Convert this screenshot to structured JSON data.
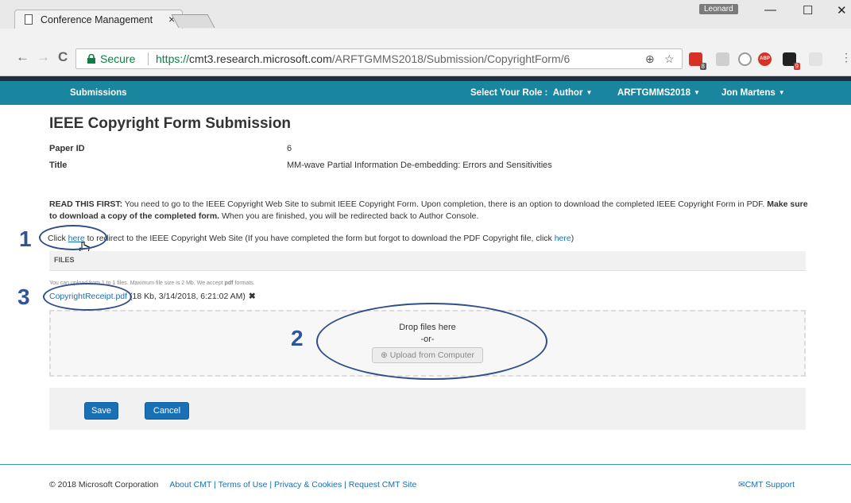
{
  "browser": {
    "tab_title": "Conference Management",
    "tab_close": "×",
    "user_badge": "Leonard",
    "minimize": "—",
    "maximize": "☐",
    "close": "✕",
    "back": "←",
    "forward": "→",
    "reload": "C",
    "secure_label": "Secure",
    "url_scheme": "https://",
    "url_host": "cmt3.research.microsoft.com",
    "url_path": "/ARFTGMMS2018/Submission/CopyrightForm/6",
    "zoom_icon": "⊕",
    "star_icon": "☆",
    "ext_badge_1": "8",
    "ext_abp": "ABP",
    "ext_badge_2": "9",
    "menu": "⋮"
  },
  "nav": {
    "submissions": "Submissions",
    "role_label": "Select Your Role :",
    "role_value": "Author",
    "conference": "ARFTGMMS2018",
    "user": "Jon Martens"
  },
  "page": {
    "title": "IEEE Copyright Form Submission",
    "paper_id_label": "Paper ID",
    "paper_id_value": "6",
    "title_label": "Title",
    "title_value": "MM-wave Partial Information De-embedding: Errors and Sensitivities",
    "notice_bold1": "READ THIS FIRST:",
    "notice_text1": " You need to go to the IEEE Copyright Web Site to submit IEEE Copyright Form. Upon completion, there is an option to download the completed IEEE Copyright Form in PDF. ",
    "notice_bold2": "Make sure to download a copy of the completed form.",
    "notice_text2": " When you are finished, you will be redirected back to Author Console.",
    "redirect_pre": "Click ",
    "redirect_link": "here",
    "redirect_mid": " to redirect to the IEEE Copyright Web Site (If you have completed the form but forgot to download the PDF Copyright file, click ",
    "redirect_link2": "here",
    "redirect_post": ")"
  },
  "files": {
    "header": "FILES",
    "hint_pre": "You can upload from 1 to 1 files. Maximum file size is 2 Mb. We accept ",
    "hint_fmt": "pdf",
    "hint_post": " formats.",
    "file_name": "CopyrightReceipt.pdf",
    "file_meta": " (18 Kb, 3/14/2018, 6:21:02 AM)",
    "remove": "✖",
    "drop_text": "Drop files here",
    "or_text": "-or-",
    "upload_icon": "⊕",
    "upload_label": "Upload from Computer"
  },
  "actions": {
    "save": "Save",
    "cancel": "Cancel"
  },
  "footer": {
    "copyright": "© 2018 Microsoft Corporation",
    "links": "About CMT | Terms of Use | Privacy & Cookies | Request CMT Site",
    "support": "✉CMT Support"
  },
  "annotations": {
    "one": "1",
    "two": "2",
    "three": "3",
    "color": "#2f5597"
  }
}
